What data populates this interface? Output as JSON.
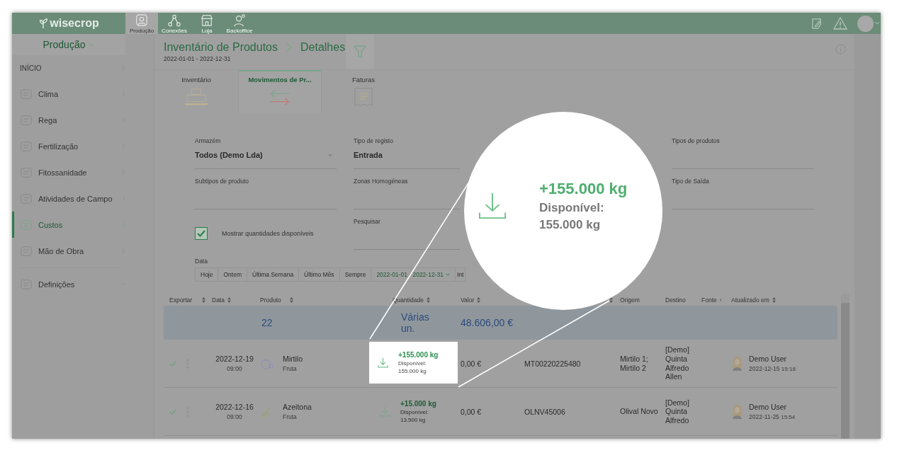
{
  "topbar": {
    "logo": "wisecrop",
    "nav": [
      {
        "label": "Produção",
        "selected": true
      },
      {
        "label": "Conexões",
        "selected": false
      },
      {
        "label": "Loja",
        "selected": false
      },
      {
        "label": "Backoffice",
        "selected": false
      }
    ]
  },
  "sidebar": {
    "module": "Produção",
    "items": [
      {
        "label": "INÍCIO",
        "kind": "header",
        "selected": false
      },
      {
        "label": "Clima",
        "kind": "module",
        "selected": false
      },
      {
        "label": "Rega",
        "kind": "module",
        "selected": false
      },
      {
        "label": "Fertilização",
        "kind": "module",
        "selected": false
      },
      {
        "label": "Fitossanidade",
        "kind": "module",
        "selected": false
      },
      {
        "label": "Atividades de Campo",
        "kind": "module",
        "selected": false
      },
      {
        "label": "Custos",
        "kind": "module",
        "selected": true
      },
      {
        "label": "Mão de Obra",
        "kind": "module",
        "selected": false
      },
      {
        "label": "Definições",
        "kind": "group",
        "selected": false
      }
    ]
  },
  "page": {
    "breadcrumb": [
      "Inventário de Produtos",
      "Detalhes"
    ],
    "date_range": "2022-01-01 - 2022-12-31"
  },
  "tabs": [
    {
      "label": "Inventário",
      "selected": false
    },
    {
      "label": "Movimentos de Pr...",
      "selected": true
    },
    {
      "label": "Faturas",
      "selected": false
    }
  ],
  "filters": [
    {
      "label": "Armazém",
      "value": "Todos (Demo Lda)",
      "kind": "select"
    },
    {
      "label": "Tipo de registo",
      "value": "Entrada",
      "kind": "text"
    },
    {
      "kind": "hidden"
    },
    {
      "label": "Tipos de produtos",
      "kind": "text"
    },
    {
      "label": "Subtipos de produto",
      "kind": "text"
    },
    {
      "label": "Zonas Homogéneas",
      "kind": "text"
    },
    {
      "kind": "hidden"
    },
    {
      "label": "Tipo de Saída",
      "kind": "text"
    },
    {
      "label": "Mostrar quantidades disponíveis",
      "kind": "checkbox",
      "checked": true
    },
    {
      "label": "Pesquisar",
      "kind": "text"
    }
  ],
  "date_filter": {
    "label": "Data",
    "options": [
      {
        "label": "Hoje",
        "selected": false
      },
      {
        "label": "Ontem",
        "selected": false
      },
      {
        "label": "Última Semana",
        "selected": false
      },
      {
        "label": "Último Mês",
        "selected": false
      },
      {
        "label": "Sempre",
        "selected": false
      },
      {
        "label": "2022-01-01 - 2022-12-31",
        "selected": true
      },
      {
        "label": "Int",
        "selected": false
      }
    ]
  },
  "table": {
    "columns": [
      {
        "label": "Exportar",
        "sortable": true
      },
      {
        "label": "Data",
        "sortable": true
      },
      {
        "label": "Produto",
        "sortable": true
      },
      {
        "label": "Quantidade",
        "sortable": true
      },
      {
        "label": "Valor",
        "sortable": true
      },
      {
        "sortable": true
      },
      {
        "label": "Origem",
        "sortable": false
      },
      {
        "label": "Destino",
        "sortable": false
      },
      {
        "label": "Fonte",
        "sortable": true
      },
      {
        "label": "Atualizado em",
        "sortable": true
      }
    ],
    "summary": {
      "product": "22",
      "quantity": "Várias un.",
      "value": "48.606,00 €"
    },
    "rows": [
      {
        "exported": true,
        "date": "2022-12-19",
        "time": "09:00",
        "product": "Mirtilo",
        "category": "Fruta",
        "quantity": "+155.000 kg",
        "available_label": "Disponível:",
        "available": "155.000 kg",
        "highlighted": true,
        "value": "0,00 €",
        "code": "MT00220225480",
        "origin": "Mirtilo 1; Mirtilo 2",
        "destination": "[Demo] Quinta Alfredo Allen",
        "user": "Demo User",
        "updated_date": "2022-12-15",
        "updated_time": "15:18"
      },
      {
        "exported": true,
        "date": "2022-12-16",
        "time": "09:00",
        "product": "Azeitona",
        "category": "Fruta",
        "quantity": "+15.000 kg",
        "available_label": "Disponível:",
        "available": "13.500 kg",
        "highlighted": false,
        "value": "0,00 €",
        "code": "OLNV45006",
        "origin": "Olival Novo",
        "destination": "[Demo] Quinta Alfredo",
        "user": "Demo User",
        "updated_date": "2022-11-25",
        "updated_time": "15:54"
      }
    ]
  },
  "magnifier": {
    "quantity": "+155.000 kg",
    "available_label": "Disponível:",
    "available": "155.000 kg"
  }
}
